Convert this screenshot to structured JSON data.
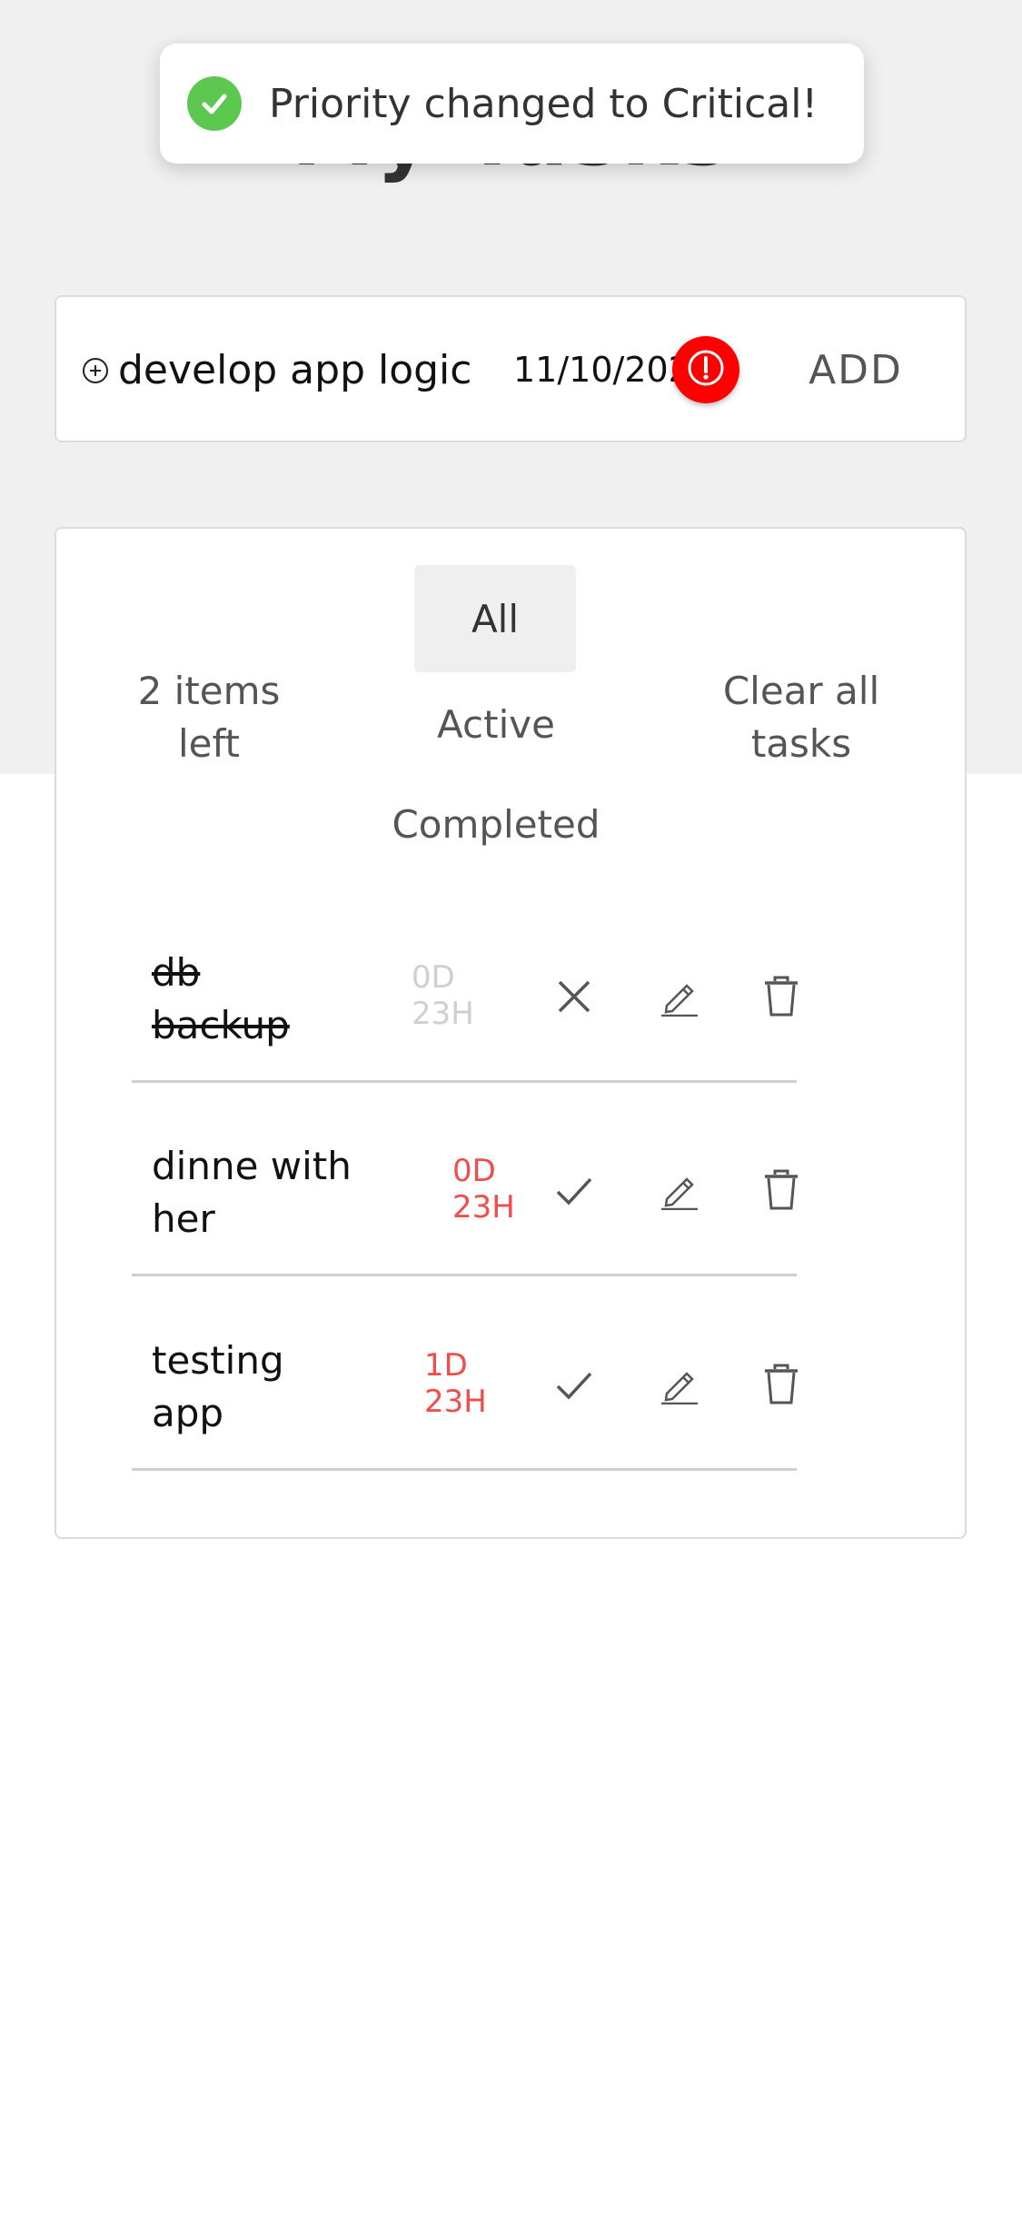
{
  "header": {
    "title": "My Tasks"
  },
  "toast": {
    "message": "Priority changed to Critical!",
    "icon": "check-circle-icon",
    "icon_color": "#5cc84f"
  },
  "add_bar": {
    "task_value": "develop app logic",
    "date_value": "11/10/2020",
    "priority_icon": "exclamation-circle-icon",
    "priority_color": "#ff0000",
    "add_label": "ADD"
  },
  "controls": {
    "items_left": "2 items left",
    "clear_all": "Clear all tasks",
    "filters": {
      "all": "All",
      "active": "Active",
      "completed": "Completed"
    },
    "selected_filter": "All"
  },
  "tasks": [
    {
      "name": "db backup",
      "due": "0D 23H",
      "completed": true,
      "toggle_icon": "close-icon"
    },
    {
      "name": "dinne with her",
      "due": "0D 23H",
      "completed": false,
      "toggle_icon": "check-icon"
    },
    {
      "name": "testing app",
      "due": "1D 23H",
      "completed": false,
      "toggle_icon": "check-icon"
    }
  ],
  "colors": {
    "overdue": "#f04d4d",
    "done_text": "#cfcfcf",
    "panel_bg": "#f0f0f0"
  }
}
